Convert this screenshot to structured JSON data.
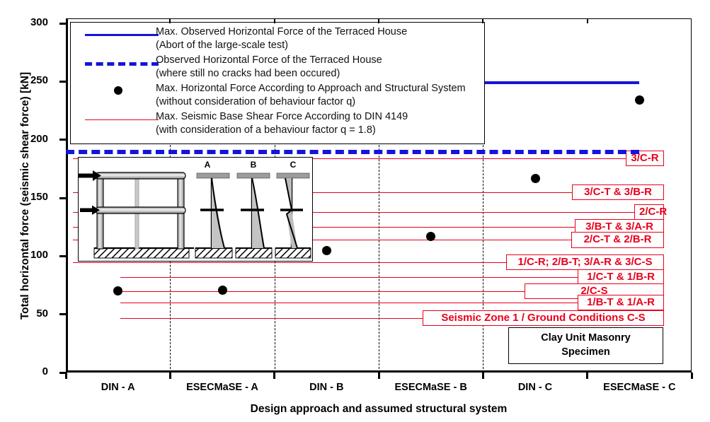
{
  "chart_data": {
    "type": "scatter",
    "title": "",
    "xlabel": "Design approach and assumed structural system",
    "ylabel": "Total horizontal force (seismic shear force) [kN]",
    "ylim": [
      0,
      300
    ],
    "yticks": [
      0,
      50,
      100,
      150,
      200,
      250,
      300
    ],
    "grid": "vertical dashed separators between category pairs",
    "legend_position": "inside top-left",
    "categories": [
      "DIN - A",
      "ESECMaSE - A",
      "DIN - B",
      "ESECMaSE - B",
      "DIN - C",
      "ESECMaSE - C"
    ],
    "series": [
      {
        "name": "Max. Horizontal Force According to Approach and Structural System",
        "type": "scatter",
        "marker": "filled-circle",
        "color": "#000000",
        "categories": [
          "DIN - A",
          "ESECMaSE - A",
          "DIN - B",
          "ESECMaSE - B",
          "DIN - C",
          "ESECMaSE - C"
        ],
        "values": [
          70,
          71,
          105,
          117,
          167,
          234
        ]
      },
      {
        "name": "Max. Observed Horizontal Force of the Terraced House",
        "type": "hline",
        "style": "solid",
        "color": "#1414dc",
        "value": 250,
        "x_from": "ESECMaSE - B",
        "x_to": "ESECMaSE - C"
      },
      {
        "name": "Observed Horizontal Force of the Terraced House",
        "type": "hline",
        "style": "dashed",
        "color": "#1414dc",
        "value": 191,
        "x_from": "axis-left",
        "x_to": "ESECMaSE - C"
      }
    ],
    "reference_lines": {
      "name": "Max. Seismic Base Shear Force According to DIN 4149",
      "color": "#e8001c",
      "style": "solid",
      "lines": [
        {
          "label": "3/C-R",
          "value": 184
        },
        {
          "label": "3/C-T & 3/B-R",
          "value": 155
        },
        {
          "label": "2/C-R",
          "value": 138
        },
        {
          "label": "3/B-T & 3/A-R",
          "value": 125
        },
        {
          "label": "2/C-T & 2/B-R",
          "value": 114
        },
        {
          "label": "1/C-R; 2/B-T; 3/A-R & 3/C-S",
          "value": 95
        },
        {
          "label": "1/C-T & 1/B-R",
          "value": 82
        },
        {
          "label": "2/C-S",
          "value": 70
        },
        {
          "label": "1/B-T & 1/A-R",
          "value": 60
        },
        {
          "label": "Seismic Zone 1 / Ground Conditions C-S",
          "value": 47
        }
      ]
    }
  },
  "axes": {
    "y_title": "Total horizontal force (seismic shear force) [kN]",
    "x_title": "Design approach and assumed structural system",
    "y_ticks": [
      "300",
      "250",
      "200",
      "150",
      "100",
      "50",
      "0"
    ],
    "x_labels": [
      "DIN - A",
      "ESECMaSE - A",
      "DIN - B",
      "ESECMaSE - B",
      "DIN - C",
      "ESECMaSE - C"
    ]
  },
  "legend": {
    "entries": [
      {
        "key": "blue-solid-line",
        "line1": "Max. Observed Horizontal Force of the Terraced House",
        "line2": "(Abort of the large-scale test)"
      },
      {
        "key": "blue-dashed-line",
        "line1": "Observed Horizontal Force of the Terraced House",
        "line2": "(where still no cracks had been occured)"
      },
      {
        "key": "black-dot-marker",
        "line1": "Max. Horizontal Force According to Approach and Structural System",
        "line2": "(without consideration of behaviour factor q)"
      },
      {
        "key": "red-thin-line",
        "line1": "Max. Seismic Base Shear Force According to DIN 4149",
        "line2": "(with consideration of a behaviour factor q = 1.8)"
      }
    ]
  },
  "callouts": [
    {
      "label": "3/C-R",
      "value": 184
    },
    {
      "label": "3/C-T & 3/B-R",
      "value": 155
    },
    {
      "label": "2/C-R",
      "value": 138
    },
    {
      "label": "3/B-T & 3/A-R",
      "value": 125
    },
    {
      "label": "2/C-T & 2/B-R",
      "value": 114
    },
    {
      "label": "1/C-R; 2/B-T; 3/A-R & 3/C-S",
      "value": 95
    },
    {
      "label": "1/C-T & 1/B-R",
      "value": 82
    },
    {
      "label": "2/C-S",
      "value": 70
    },
    {
      "label": "1/B-T & 1/A-R",
      "value": 60
    },
    {
      "label": "Seismic Zone 1 / Ground Conditions C-S",
      "value": 47
    }
  ],
  "specimen_box": {
    "line1": "Clay Unit Masonry",
    "line2": "Specimen"
  },
  "inset": {
    "description": "Two-storey frame with two lateral load arrows and three assumed structural system diagrams",
    "system_labels": [
      "A",
      "B",
      "C"
    ]
  },
  "colors": {
    "series_blue": "#1414dc",
    "reference_red": "#e8001c",
    "marker_black": "#000000",
    "axis_black": "#000000"
  }
}
